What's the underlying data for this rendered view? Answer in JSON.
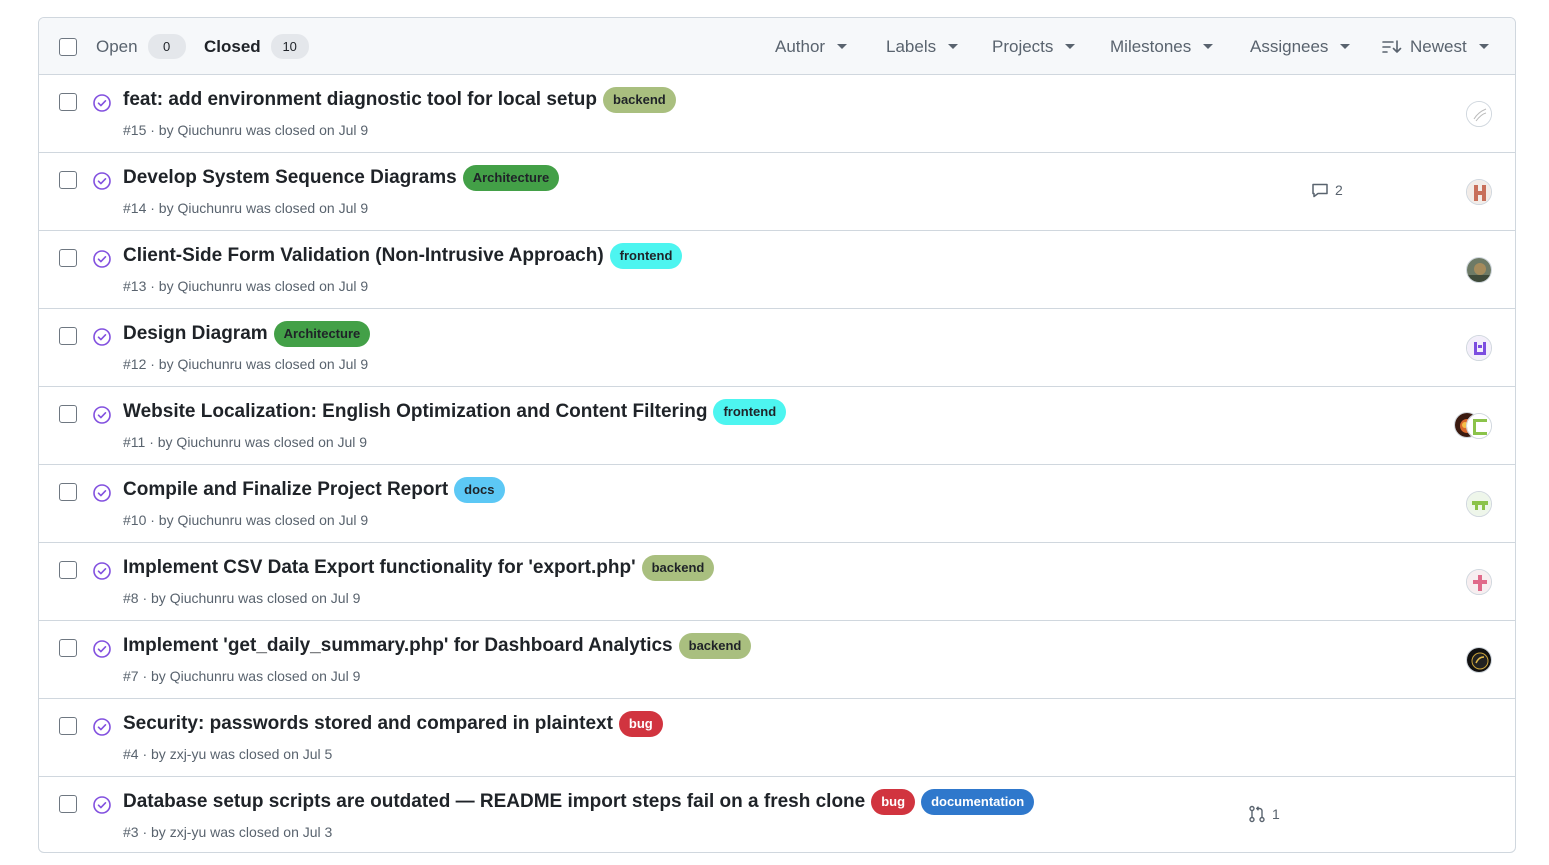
{
  "header": {
    "open_label": "Open",
    "open_count": "0",
    "closed_label": "Closed",
    "closed_count": "10",
    "filters": [
      "Author",
      "Labels",
      "Projects",
      "Milestones",
      "Assignees"
    ],
    "sort_label": "Newest"
  },
  "colors": {
    "closed_icon": "#8250df",
    "backend": "#a9bf7f",
    "architecture": "#43a047",
    "frontend": "#4df5f0",
    "docs": "#5cc8f5",
    "bug": "#d1343f",
    "documentation": "#2f78cc"
  },
  "issues": [
    {
      "title": "feat: add environment diagnostic tool for local setup",
      "labels": [
        {
          "text": "backend"
        }
      ],
      "meta": "#15 · by Qiuchunru was closed on Jul 9",
      "comments": "",
      "prs": ""
    },
    {
      "title": "Develop System Sequence Diagrams",
      "labels": [
        {
          "text": "Architecture"
        }
      ],
      "meta": "#14 · by Qiuchunru was closed on Jul 9",
      "comments": "2",
      "prs": ""
    },
    {
      "title": "Client-Side Form Validation (Non-Intrusive Approach)",
      "labels": [
        {
          "text": "frontend"
        }
      ],
      "meta": "#13 · by Qiuchunru was closed on Jul 9",
      "comments": "",
      "prs": ""
    },
    {
      "title": "Design Diagram",
      "labels": [
        {
          "text": "Architecture"
        }
      ],
      "meta": "#12 · by Qiuchunru was closed on Jul 9",
      "comments": "",
      "prs": ""
    },
    {
      "title": "Website Localization: English Optimization and Content Filtering",
      "labels": [
        {
          "text": "frontend"
        }
      ],
      "meta": "#11 · by Qiuchunru was closed on Jul 9",
      "comments": "",
      "prs": ""
    },
    {
      "title": "Compile and Finalize Project Report",
      "labels": [
        {
          "text": "docs"
        }
      ],
      "meta": "#10 · by Qiuchunru was closed on Jul 9",
      "comments": "",
      "prs": ""
    },
    {
      "title": "Implement CSV Data Export functionality for 'export.php'",
      "labels": [
        {
          "text": "backend"
        }
      ],
      "meta": "#8 · by Qiuchunru was closed on Jul 9",
      "comments": "",
      "prs": ""
    },
    {
      "title": "Implement 'get_daily_summary.php' for Dashboard Analytics",
      "labels": [
        {
          "text": "backend"
        }
      ],
      "meta": "#7 · by Qiuchunru was closed on Jul 9",
      "comments": "",
      "prs": ""
    },
    {
      "title": "Security: passwords stored and compared in plaintext",
      "labels": [
        {
          "text": "bug"
        }
      ],
      "meta": "#4 · by zxj-yu was closed on Jul 5",
      "comments": "",
      "prs": ""
    },
    {
      "title": "Database setup scripts are outdated — README import steps fail on a fresh clone",
      "labels": [
        {
          "text": "bug"
        },
        {
          "text": "documentation"
        }
      ],
      "meta": "#3 · by zxj-yu was closed on Jul 3",
      "comments": "",
      "prs": "1"
    }
  ]
}
